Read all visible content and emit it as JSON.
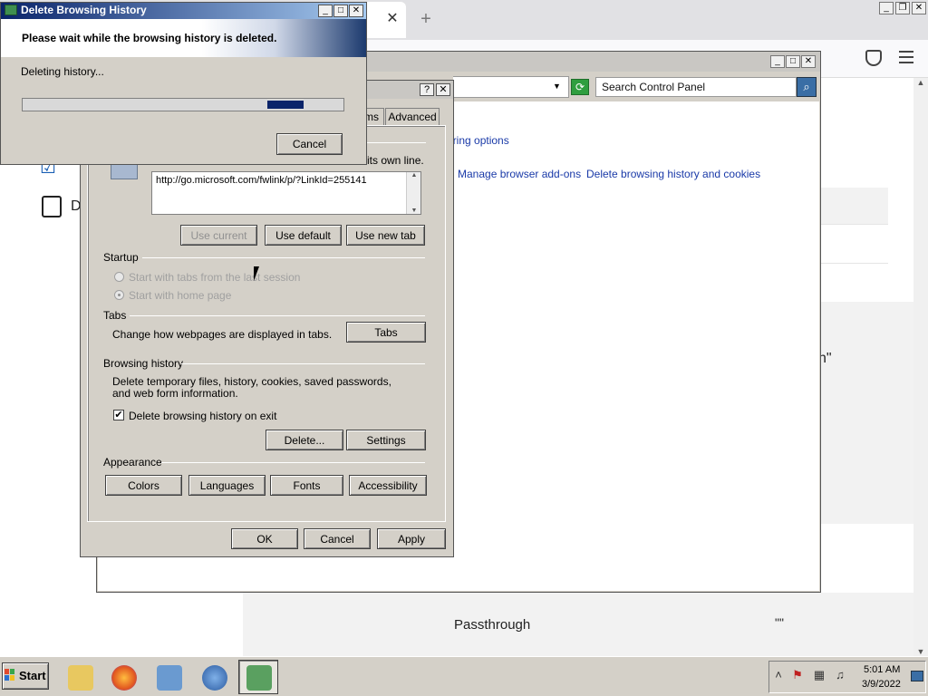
{
  "browser": {
    "tab_close": "✕",
    "new_tab": "+",
    "page": {
      "label_d": "D",
      "quote1": "n\"",
      "passthrough": "Passthrough",
      "quote2": "\"\""
    }
  },
  "control_panel": {
    "search_placeholder": "Search Control Panel",
    "links": {
      "sharing_options": "aring options",
      "manage_addons": "Manage browser add-ons",
      "delete_history": "Delete browsing history and cookies"
    }
  },
  "internet_options": {
    "tabs": {
      "programs": "ms",
      "advanced": "Advanced"
    },
    "homepage": {
      "line_suffix": "its own line.",
      "url": "http://go.microsoft.com/fwlink/p/?LinkId=255141",
      "use_current": "Use current",
      "use_default": "Use default",
      "use_new_tab": "Use new tab"
    },
    "startup": {
      "label": "Startup",
      "option_last_session": "Start with tabs from the last session",
      "option_home_page": "Start with home page"
    },
    "tabs_section": {
      "label": "Tabs",
      "description": "Change how webpages are displayed in tabs.",
      "button": "Tabs"
    },
    "browsing_history": {
      "label": "Browsing history",
      "description": "Delete temporary files, history, cookies, saved passwords, and web form information.",
      "delete_on_exit_label": "Delete browsing history on exit",
      "delete_on_exit_checked": true,
      "delete_button": "Delete...",
      "settings_button": "Settings"
    },
    "appearance": {
      "label": "Appearance",
      "colors": "Colors",
      "languages": "Languages",
      "fonts": "Fonts",
      "accessibility": "Accessibility"
    },
    "footer": {
      "ok": "OK",
      "cancel": "Cancel",
      "apply": "Apply"
    },
    "help": "?",
    "close": "✕"
  },
  "delete_dialog": {
    "title": "Delete Browsing History",
    "heading": "Please wait while the browsing history is deleted.",
    "status": "Deleting history...",
    "cancel": "Cancel",
    "progress_block_position": 0.82
  },
  "taskbar": {
    "start": "Start",
    "clock_time": "5:01 AM",
    "clock_date": "3/9/2022"
  },
  "colors": {
    "title_gradient_start": "#0a246a",
    "progress_fill": "#0a246a",
    "link": "#1a3aa8"
  }
}
